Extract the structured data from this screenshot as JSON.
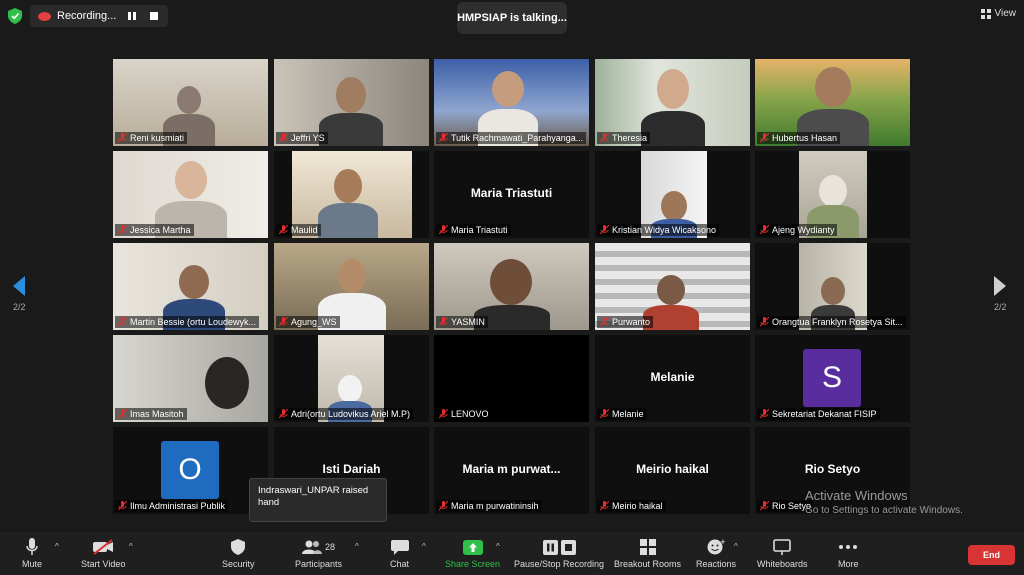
{
  "topbar": {
    "recording_label": "Recording...",
    "talking_label": "HMPSIAP is talking...",
    "view_label": "View"
  },
  "pager": {
    "left_page": "2/2",
    "right_page": "2/2"
  },
  "tiles": [
    {
      "name": "Reni kusmiati"
    },
    {
      "name": "Jeffri YS"
    },
    {
      "name": "Tutik Rachmawati_Parahyanga..."
    },
    {
      "name": "Theresia"
    },
    {
      "name": "Hubertus Hasan"
    },
    {
      "name": "Jessica Martha"
    },
    {
      "name": "Maulid"
    },
    {
      "name": "Maria Triastuti",
      "big_name": "Maria Triastuti"
    },
    {
      "name": "Kristian Widya Wicaksono"
    },
    {
      "name": "Ajeng Wydianty"
    },
    {
      "name": "Martin Bessie (ortu Loudewyk..."
    },
    {
      "name": "Agung_WS"
    },
    {
      "name": "YASMIN"
    },
    {
      "name": "Purwanto"
    },
    {
      "name": "Orangtua Franklyn Rosetya Sit..."
    },
    {
      "name": "Imas Masitoh"
    },
    {
      "name": "Adri(ortu Ludovikus Ariel M.P)"
    },
    {
      "name": "LENOVO"
    },
    {
      "name": "Melanie",
      "big_name": "Melanie"
    },
    {
      "name": "Sekretariat Dekanat FISIP",
      "avatar_letter": "S",
      "avatar_color": "#5a2d9e"
    },
    {
      "name": "Ilmu Administrasi Publik",
      "avatar_letter": "O",
      "avatar_color": "#1f6bbf"
    },
    {
      "name": "Indraswari_UNPAR",
      "big_name": "Isti Dariah"
    },
    {
      "name": "Maria m purwatininsih",
      "big_name": "Maria m purwat..."
    },
    {
      "name": "Meirio haikal",
      "big_name": "Meirio haikal"
    },
    {
      "name": "Rio Setyo",
      "big_name": "Rio Setyo"
    }
  ],
  "toast": {
    "text": "Indraswari_UNPAR raised hand"
  },
  "watermark": {
    "title": "Activate Windows",
    "subtitle": "Go to Settings to activate Windows."
  },
  "toolbar": {
    "mute": "Mute",
    "start_video": "Start Video",
    "security": "Security",
    "participants": "Participants",
    "participants_count": "28",
    "chat": "Chat",
    "share_screen": "Share Screen",
    "pause_recording": "Pause/Stop Recording",
    "breakout_rooms": "Breakout Rooms",
    "reactions": "Reactions",
    "whiteboards": "Whiteboards",
    "more": "More",
    "end": "End"
  },
  "colors": {
    "share_green": "#2fbf4a",
    "end_red": "#d93434",
    "muted_red": "#e03030"
  }
}
